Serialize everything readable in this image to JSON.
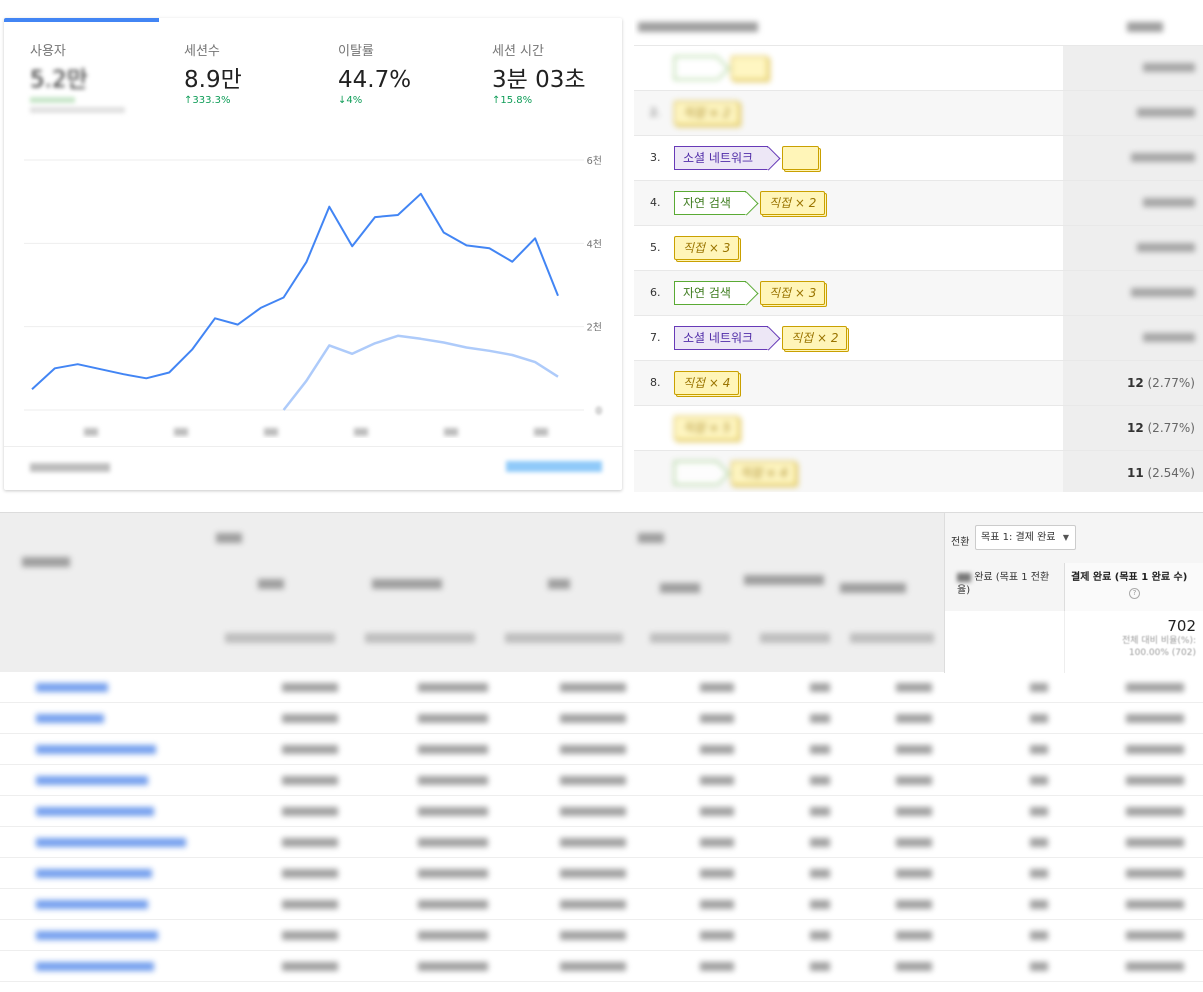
{
  "overview": {
    "metrics": [
      {
        "label": "사용자",
        "value": "5.2만",
        "change": "",
        "active": true
      },
      {
        "label": "세션수",
        "value": "8.9만",
        "change": "↑333.3%"
      },
      {
        "label": "이탈률",
        "value": "44.7%",
        "change": "↓4%"
      },
      {
        "label": "세션 시간",
        "value": "3분 03초",
        "change": "↑15.8%"
      }
    ],
    "chart_data": {
      "type": "line",
      "title": "",
      "xlabel": "",
      "ylabel": "",
      "y_tick_labels": [
        "0",
        "2천",
        "4천",
        "6천"
      ],
      "ylim": [
        0,
        6000
      ],
      "grid": true,
      "legend": "none",
      "series": [
        {
          "color": "#4285f4",
          "values": [
            500,
            1000,
            1100,
            980,
            860,
            760,
            900,
            1450,
            2200,
            2050,
            2450,
            2700,
            3550,
            4880,
            3930,
            4630,
            4680,
            5190,
            4260,
            3950,
            3880,
            3560,
            4120,
            2740
          ]
        },
        {
          "color": "#aecbfa",
          "values": [
            null,
            null,
            null,
            null,
            null,
            null,
            null,
            null,
            null,
            null,
            null,
            0,
            700,
            1550,
            1350,
            1600,
            1780,
            1710,
            1620,
            1500,
            1420,
            1320,
            1150,
            800
          ]
        }
      ]
    }
  },
  "paths": {
    "rows": [
      {
        "num": "",
        "chips": [
          {
            "type": "organic",
            "text": ""
          },
          {
            "type": "direct",
            "text": ""
          }
        ],
        "count": "",
        "pct": "",
        "blur": true
      },
      {
        "num": "2.",
        "chips": [
          {
            "type": "direct",
            "text": "직접 × 2"
          }
        ],
        "count": "",
        "pct": "",
        "blur": true
      },
      {
        "num": "3.",
        "chips": [
          {
            "type": "social",
            "text": "소셜 네트워크"
          },
          {
            "type": "direct",
            "text": ""
          }
        ],
        "count": "",
        "pct": "",
        "blur": false
      },
      {
        "num": "4.",
        "chips": [
          {
            "type": "organic",
            "text": "자연 검색"
          },
          {
            "type": "direct",
            "text": "직접 × 2"
          }
        ],
        "count": "",
        "pct": "",
        "blur": false
      },
      {
        "num": "5.",
        "chips": [
          {
            "type": "direct",
            "text": "직접 × 3"
          }
        ],
        "count": "",
        "pct": "",
        "blur": false
      },
      {
        "num": "6.",
        "chips": [
          {
            "type": "organic",
            "text": "자연 검색"
          },
          {
            "type": "direct",
            "text": "직접 × 3"
          }
        ],
        "count": "",
        "pct": "",
        "blur": false
      },
      {
        "num": "7.",
        "chips": [
          {
            "type": "social",
            "text": "소셜 네트워크"
          },
          {
            "type": "direct",
            "text": "직접 × 2"
          }
        ],
        "count": "",
        "pct": "",
        "blur": false
      },
      {
        "num": "8.",
        "chips": [
          {
            "type": "direct",
            "text": "직접 × 4"
          }
        ],
        "count": "12",
        "pct": "(2.77%)",
        "blur": false
      },
      {
        "num": "",
        "chips": [
          {
            "type": "direct",
            "text": "직접 × 5"
          }
        ],
        "count": "12",
        "pct": "(2.77%)",
        "blur": true
      },
      {
        "num": "",
        "chips": [
          {
            "type": "organic",
            "text": ""
          },
          {
            "type": "direct",
            "text": "직접 × 4"
          }
        ],
        "count": "11",
        "pct": "(2.54%)",
        "blur": true
      }
    ]
  },
  "table": {
    "conversion_label": "전환",
    "goal_select": "목표 1: 결제 완료",
    "goal_rate_header": "완료 (목표 1 전환율)",
    "goal_count_header": "결제 완료 (목표 1 완료 수)",
    "help_mark": "?",
    "total_value": "702",
    "total_sub1": "전체 대비 비율(%):",
    "total_sub2": "100.00% (702)"
  }
}
